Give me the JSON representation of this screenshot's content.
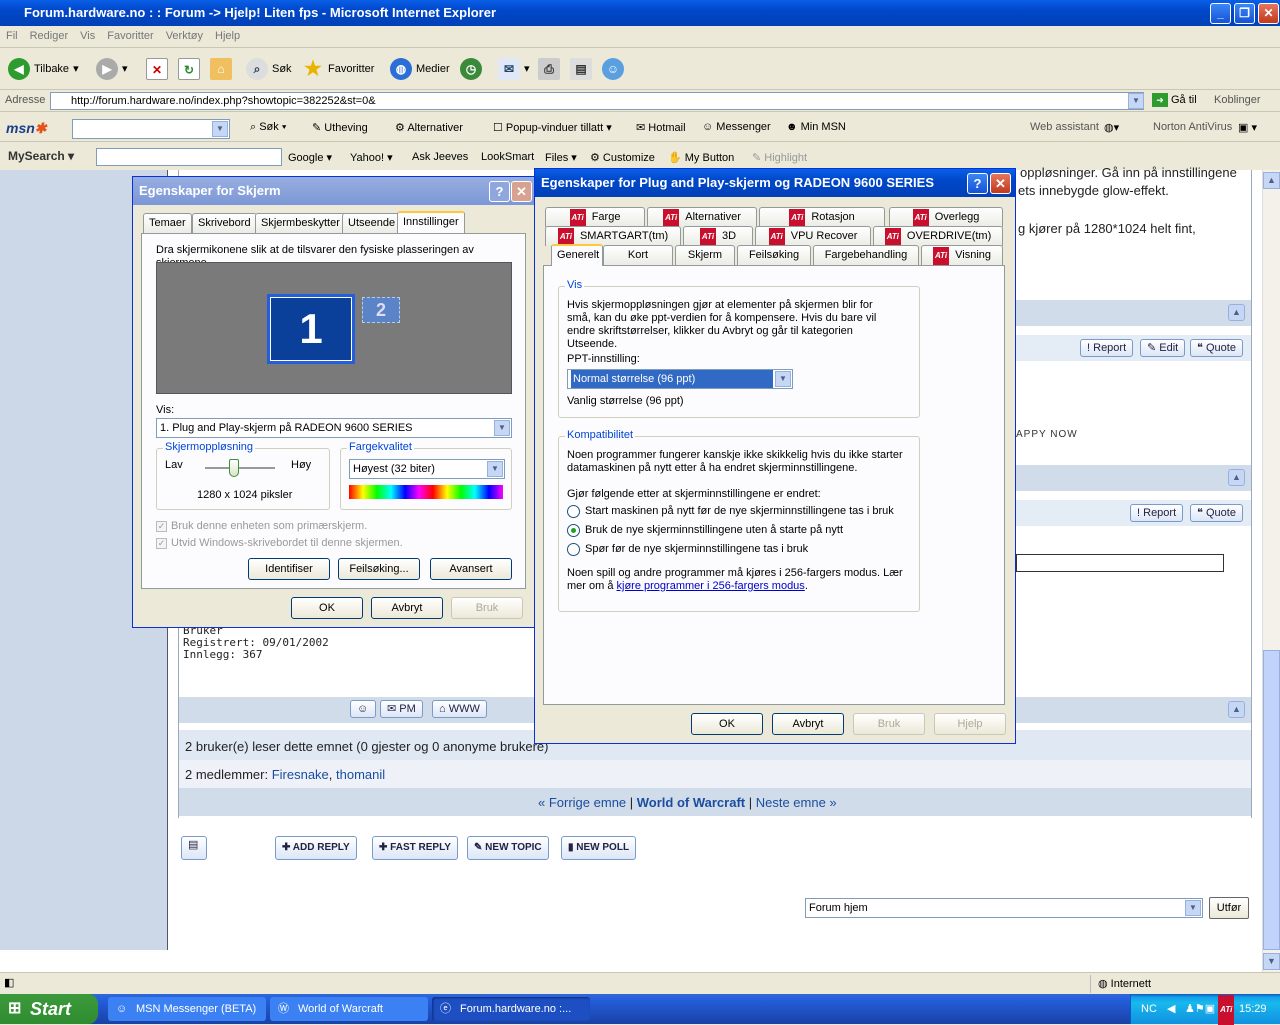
{
  "window": {
    "title": "Forum.hardware.no : : Forum -> Hjelp! Liten fps - Microsoft Internet Explorer"
  },
  "menu": [
    "Fil",
    "Rediger",
    "Vis",
    "Favoritter",
    "Verktøy",
    "Hjelp"
  ],
  "toolbar": {
    "back": "Tilbake",
    "search": "Søk",
    "favorites": "Favoritter",
    "media": "Medier"
  },
  "address": {
    "label": "Adresse",
    "url": "http://forum.hardware.no/index.php?showtopic=382252&st=0&",
    "go": "Gå til",
    "links": "Koblinger"
  },
  "msnbar": {
    "search": "Søk",
    "highlight": "Utheving",
    "options": "Alternativer",
    "popup": "Popup-vinduer tillatt",
    "hotmail": "Hotmail",
    "messenger": "Messenger",
    "mymsn": "Min MSN",
    "web_assistant": "Web assistant",
    "norton": "Norton AntiVirus"
  },
  "searchbar": {
    "mysearch": "MySearch",
    "google": "Google",
    "yahoo": "Yahoo!",
    "ask": "Ask Jeeves",
    "looksmart": "LookSmart",
    "files": "Files",
    "customize": "Customize",
    "mybutton": "My Button",
    "highlight": "Highlight"
  },
  "forum": {
    "post_text_1": "oppløsninger. Gå inn på innstillingene",
    "post_text_2": "ets innebygde glow-effekt.",
    "post_text_3": "g kjører på 1280*1024 helt fint,",
    "sig_text": "APPY NOW",
    "btn_report": "Report",
    "btn_edit": "Edit",
    "btn_quote": "Quote",
    "user_role": "Bruker",
    "registered": "Registrert: 09/01/2002",
    "posts": "Innlegg: 367",
    "btn_pm": "PM",
    "btn_www": "WWW",
    "readers": "2 bruker(e) leser dette emnet (0 gjester og 0 anonyme brukere)",
    "members_label": "2 medlemmer:",
    "member1": "Firesnake",
    "member2": "thomanil",
    "prev": "« Forrige emne",
    "topic": "World of Warcraft",
    "next": "Neste emne »",
    "add_reply": "ADD REPLY",
    "fast_reply": "FAST REPLY",
    "new_topic": "NEW TOPIC",
    "new_poll": "NEW POLL",
    "jump_value": "Forum hjem",
    "jump_btn": "Utfør"
  },
  "dlg1": {
    "title": "Egenskaper for Skjerm",
    "tabs": [
      "Temaer",
      "Skrivebord",
      "Skjermbeskytter",
      "Utseende",
      "Innstillinger"
    ],
    "instruction": "Dra skjermikonene slik at de tilsvarer den fysiske plasseringen av skjermene.",
    "mon1": "1",
    "mon2": "2",
    "vis_label": "Vis:",
    "vis_value": "1. Plug and Play-skjerm på RADEON 9600 SERIES",
    "res_group": "Skjermoppløsning",
    "low": "Lav",
    "high": "Høy",
    "res_value": "1280 x 1024 piksler",
    "color_group": "Fargekvalitet",
    "color_value": "Høyest (32 biter)",
    "chk1": "Bruk denne enheten som primærskjerm.",
    "chk2": "Utvid Windows-skrivebordet til denne skjermen.",
    "identify": "Identifiser",
    "troubleshoot": "Feilsøking...",
    "advanced": "Avansert",
    "ok": "OK",
    "cancel": "Avbryt",
    "apply": "Bruk"
  },
  "dlg2": {
    "title": "Egenskaper for Plug and Play-skjerm og RADEON 9600 SERIES",
    "tabs_row1": [
      "Farge",
      "Alternativer",
      "Rotasjon",
      "Overlegg"
    ],
    "tabs_row2": [
      "SMARTGART(tm)",
      "3D",
      "VPU Recover",
      "OVERDRIVE(tm)"
    ],
    "tabs_row3": [
      "Generelt",
      "Kort",
      "Skjerm",
      "Feilsøking",
      "Fargebehandling",
      "Visning"
    ],
    "ati": "ATi",
    "vis_group": "Vis",
    "vis_text": "Hvis skjermoppløsningen gjør at elementer på skjermen blir for små, kan du øke ppt-verdien for å kompensere. Hvis du bare vil endre skriftstørrelser, klikker du Avbryt og går til kategorien Utseende.",
    "dpi_label": "PPT-innstilling:",
    "dpi_value": "Normal størrelse (96 ppt)",
    "dpi_note": "Vanlig størrelse (96 ppt)",
    "compat_group": "Kompatibilitet",
    "compat_text": "Noen programmer fungerer kanskje ikke skikkelig hvis du ikke starter datamaskinen på nytt etter å ha endret skjerminnstillingene.",
    "after_label": "Gjør følgende etter at skjerminnstillingene er endret:",
    "radio1": "Start maskinen på nytt før de nye skjerminnstillingene tas i bruk",
    "radio2": "Bruk de nye skjerminnstillingene uten å starte på nytt",
    "radio3": "Spør før de nye skjerminnstillingene tas i bruk",
    "games_text": "Noen spill og andre programmer må kjøres i 256-fargers modus. Lær mer om å ",
    "games_link": "kjøre programmer i 256-fargers modus",
    "ok": "OK",
    "cancel": "Avbryt",
    "apply": "Bruk",
    "help": "Hjelp"
  },
  "status": {
    "zone": "Internett"
  },
  "taskbar": {
    "start": "Start",
    "task1": "MSN Messenger (BETA)",
    "task2": "World of Warcraft",
    "task3": "Forum.hardware.no :...",
    "lang": "NC",
    "clock": "15:29"
  }
}
